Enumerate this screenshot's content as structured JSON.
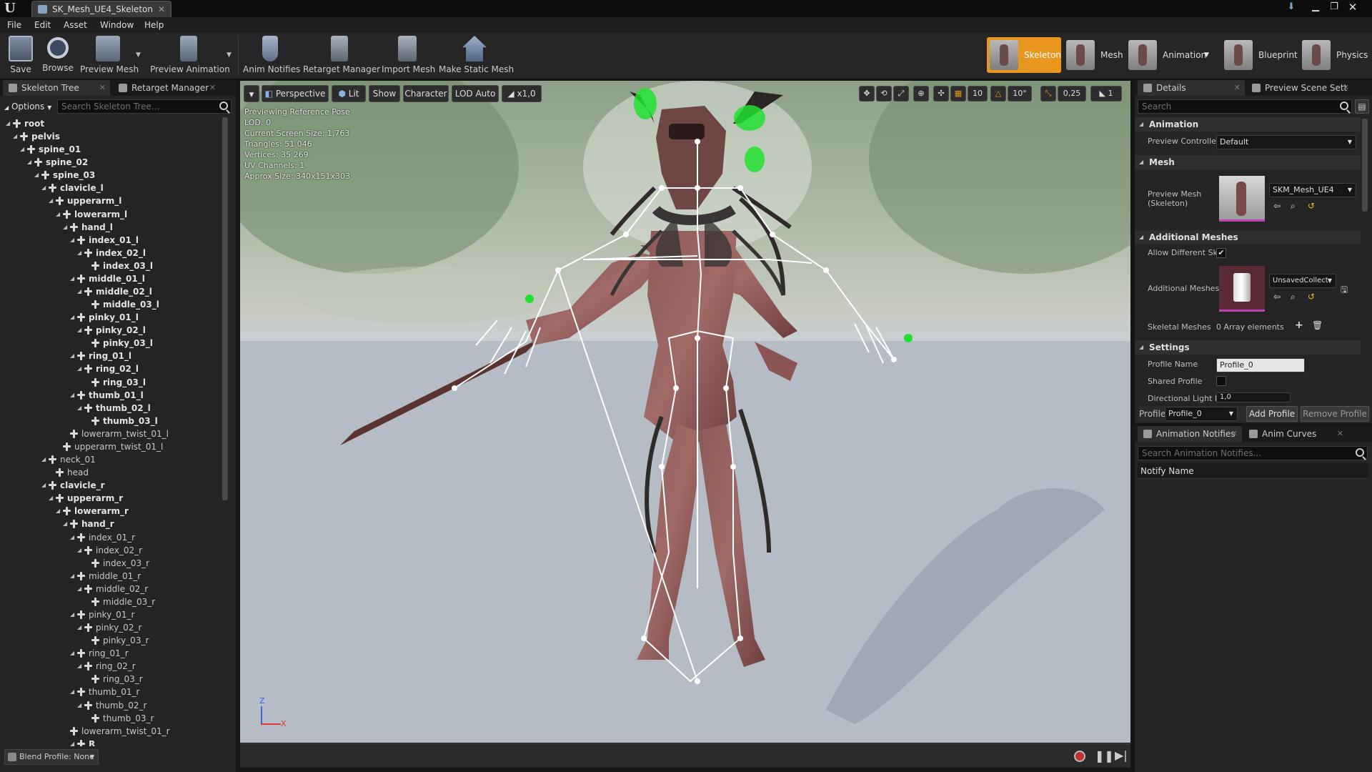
{
  "window": {
    "tab_title": "SK_Mesh_UE4_Skeleton"
  },
  "menu": [
    "File",
    "Edit",
    "Asset",
    "Window",
    "Help"
  ],
  "toolbar": {
    "save": "Save",
    "browse": "Browse",
    "preview_mesh": "Preview Mesh",
    "preview_animation": "Preview Animation",
    "anim_notifies": "Anim Notifies",
    "retarget_manager": "Retarget Manager",
    "import_mesh": "Import Mesh",
    "make_static_mesh": "Make Static Mesh"
  },
  "modes": {
    "skeleton": "Skeleton",
    "mesh": "Mesh",
    "animation": "Animation",
    "blueprint": "Blueprint",
    "physics": "Physics",
    "active": "Skeleton"
  },
  "left_tabs": {
    "skeleton_tree": "Skeleton Tree",
    "retarget_manager": "Retarget Manager"
  },
  "skeleton_tree": {
    "options": "Options",
    "search_placeholder": "Search Skeleton Tree...",
    "bones": [
      {
        "name": "root",
        "depth": 0,
        "bold": true,
        "expander": "open"
      },
      {
        "name": "pelvis",
        "depth": 1,
        "bold": true,
        "expander": "open"
      },
      {
        "name": "spine_01",
        "depth": 2,
        "bold": true,
        "expander": "open"
      },
      {
        "name": "spine_02",
        "depth": 3,
        "bold": true,
        "expander": "open"
      },
      {
        "name": "spine_03",
        "depth": 4,
        "bold": true,
        "expander": "open"
      },
      {
        "name": "clavicle_l",
        "depth": 5,
        "bold": true,
        "expander": "open"
      },
      {
        "name": "upperarm_l",
        "depth": 6,
        "bold": true,
        "expander": "open"
      },
      {
        "name": "lowerarm_l",
        "depth": 7,
        "bold": true,
        "expander": "open"
      },
      {
        "name": "hand_l",
        "depth": 8,
        "bold": true,
        "expander": "open"
      },
      {
        "name": "index_01_l",
        "depth": 9,
        "bold": true,
        "expander": "open"
      },
      {
        "name": "index_02_l",
        "depth": 10,
        "bold": true,
        "expander": "open"
      },
      {
        "name": "index_03_l",
        "depth": 11,
        "bold": true,
        "expander": "none"
      },
      {
        "name": "middle_01_l",
        "depth": 9,
        "bold": true,
        "expander": "open"
      },
      {
        "name": "middle_02_l",
        "depth": 10,
        "bold": true,
        "expander": "open"
      },
      {
        "name": "middle_03_l",
        "depth": 11,
        "bold": true,
        "expander": "none"
      },
      {
        "name": "pinky_01_l",
        "depth": 9,
        "bold": true,
        "expander": "open"
      },
      {
        "name": "pinky_02_l",
        "depth": 10,
        "bold": true,
        "expander": "open"
      },
      {
        "name": "pinky_03_l",
        "depth": 11,
        "bold": true,
        "expander": "none"
      },
      {
        "name": "ring_01_l",
        "depth": 9,
        "bold": true,
        "expander": "open"
      },
      {
        "name": "ring_02_l",
        "depth": 10,
        "bold": true,
        "expander": "open"
      },
      {
        "name": "ring_03_l",
        "depth": 11,
        "bold": true,
        "expander": "none"
      },
      {
        "name": "thumb_01_l",
        "depth": 9,
        "bold": true,
        "expander": "open"
      },
      {
        "name": "thumb_02_l",
        "depth": 10,
        "bold": true,
        "expander": "open"
      },
      {
        "name": "thumb_03_l",
        "depth": 11,
        "bold": true,
        "expander": "none"
      },
      {
        "name": "lowerarm_twist_01_l",
        "depth": 8,
        "bold": false,
        "expander": "none"
      },
      {
        "name": "upperarm_twist_01_l",
        "depth": 7,
        "bold": false,
        "expander": "none"
      },
      {
        "name": "neck_01",
        "depth": 5,
        "bold": false,
        "expander": "open"
      },
      {
        "name": "head",
        "depth": 6,
        "bold": false,
        "expander": "none"
      },
      {
        "name": "clavicle_r",
        "depth": 5,
        "bold": true,
        "expander": "open"
      },
      {
        "name": "upperarm_r",
        "depth": 6,
        "bold": true,
        "expander": "open"
      },
      {
        "name": "lowerarm_r",
        "depth": 7,
        "bold": true,
        "expander": "open"
      },
      {
        "name": "hand_r",
        "depth": 8,
        "bold": true,
        "expander": "open"
      },
      {
        "name": "index_01_r",
        "depth": 9,
        "bold": false,
        "expander": "open"
      },
      {
        "name": "index_02_r",
        "depth": 10,
        "bold": false,
        "expander": "open"
      },
      {
        "name": "index_03_r",
        "depth": 11,
        "bold": false,
        "expander": "none"
      },
      {
        "name": "middle_01_r",
        "depth": 9,
        "bold": false,
        "expander": "open"
      },
      {
        "name": "middle_02_r",
        "depth": 10,
        "bold": false,
        "expander": "open"
      },
      {
        "name": "middle_03_r",
        "depth": 11,
        "bold": false,
        "expander": "none"
      },
      {
        "name": "pinky_01_r",
        "depth": 9,
        "bold": false,
        "expander": "open"
      },
      {
        "name": "pinky_02_r",
        "depth": 10,
        "bold": false,
        "expander": "open"
      },
      {
        "name": "pinky_03_r",
        "depth": 11,
        "bold": false,
        "expander": "none"
      },
      {
        "name": "ring_01_r",
        "depth": 9,
        "bold": false,
        "expander": "open"
      },
      {
        "name": "ring_02_r",
        "depth": 10,
        "bold": false,
        "expander": "open"
      },
      {
        "name": "ring_03_r",
        "depth": 11,
        "bold": false,
        "expander": "none"
      },
      {
        "name": "thumb_01_r",
        "depth": 9,
        "bold": false,
        "expander": "open"
      },
      {
        "name": "thumb_02_r",
        "depth": 10,
        "bold": false,
        "expander": "open"
      },
      {
        "name": "thumb_03_r",
        "depth": 11,
        "bold": false,
        "expander": "none"
      },
      {
        "name": "lowerarm_twist_01_r",
        "depth": 8,
        "bold": false,
        "expander": "none"
      },
      {
        "name": "R",
        "depth": 9,
        "bold": true,
        "expander": "open"
      }
    ],
    "blend_profile": "Blend Profile: None"
  },
  "viewport": {
    "buttons": {
      "perspective": "Perspective",
      "lit": "Lit",
      "show": "Show",
      "character": "Character",
      "lod": "LOD Auto",
      "speed": "x1,0"
    },
    "right_values": {
      "grid": "10",
      "rotation": "10°",
      "scale": "0,25",
      "camera_speed": "1"
    },
    "info": [
      "Previewing Reference Pose",
      "LOD: 0",
      "Current Screen Size: 1,763",
      "Triangles: 51 046",
      "Vertices: 35 269",
      "UV Channels: 1",
      "Approx Size: 340x151x303"
    ],
    "axis": {
      "z": "Z",
      "x": "X"
    }
  },
  "details": {
    "tab_details": "Details",
    "tab_preview": "Preview Scene Sett",
    "search_placeholder": "Search",
    "sections": {
      "animation": "Animation",
      "mesh": "Mesh",
      "additional": "Additional Meshes",
      "settings": "Settings"
    },
    "preview_controller_label": "Preview Controller",
    "preview_controller_value": "Default",
    "preview_mesh_label": "Preview Mesh (Skeleton)",
    "preview_mesh_value": "SKM_Mesh_UE4",
    "allow_different_label": "Allow Different Sk",
    "additional_meshes_label": "Additional Meshes",
    "additional_meshes_value": "UnsavedCollect",
    "skeletal_meshes_label": "Skeletal Meshes",
    "skeletal_meshes_value": "0 Array elements",
    "profile_name_label": "Profile Name",
    "profile_name_value": "Profile_0",
    "shared_profile_label": "Shared Profile",
    "directional_light_label": "Directional Light Ir",
    "directional_light_value": "1,0",
    "profile_label": "Profile",
    "profile_value": "Profile_0",
    "add_profile": "Add Profile",
    "remove_profile": "Remove Profile"
  },
  "notifies": {
    "tab_notifies": "Animation Notifies",
    "tab_curves": "Anim Curves",
    "search_placeholder": "Search Animation Notifies...",
    "column": "Notify Name"
  },
  "colors": {
    "accent": "#e8961e",
    "bone": "#ffffff",
    "gizmo_green": "#22e030"
  }
}
